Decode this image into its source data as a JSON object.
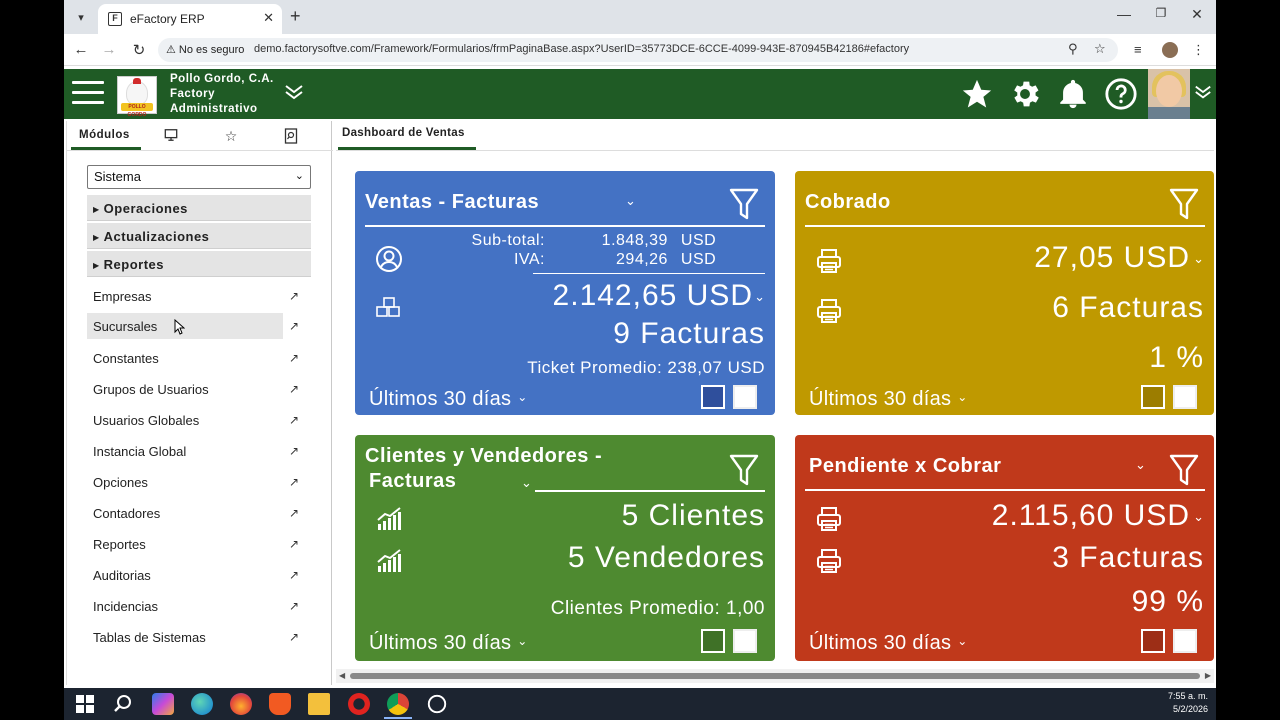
{
  "browser": {
    "tab_title": "eFactory ERP",
    "security_label": "No es seguro",
    "url": "demo.factorysoftve.com/Framework/Formularios/frmPaginaBase.aspx?UserID=35773DCE-6CCE-4099-943E-870945B42186#efactory"
  },
  "header": {
    "company_line1": "Pollo Gordo, C.A.",
    "company_line2": "Factory",
    "company_line3": "Administrativo",
    "logo_text": "POLLO GORDO"
  },
  "sidebar": {
    "tab_label": "Módulos",
    "select_value": "Sistema",
    "groups": [
      "Operaciones",
      "Actualizaciones",
      "Reportes"
    ],
    "items": [
      {
        "label": "Empresas"
      },
      {
        "label": "Sucursales"
      },
      {
        "label": "Constantes"
      },
      {
        "label": "Grupos de Usuarios"
      },
      {
        "label": "Usuarios Globales"
      },
      {
        "label": "Instancia Global"
      },
      {
        "label": "Opciones"
      },
      {
        "label": "Contadores"
      },
      {
        "label": "Reportes"
      },
      {
        "label": "Auditorias"
      },
      {
        "label": "Incidencias"
      },
      {
        "label": "Tablas de Sistemas"
      }
    ]
  },
  "main": {
    "tab_label": "Dashboard de Ventas"
  },
  "cards": {
    "ventas": {
      "title": "Ventas -  Facturas",
      "subtotal_label": "Sub-total:",
      "subtotal_value": "1.848,39",
      "subtotal_currency": "USD",
      "iva_label": "IVA:",
      "iva_value": "294,26",
      "iva_currency": "USD",
      "total": "2.142,65  USD",
      "count": "9 Facturas",
      "ticket": "Ticket Promedio: 238,07 USD",
      "range": "Últimos 30 días",
      "color": "#4472c4"
    },
    "cobrado": {
      "title": "Cobrado",
      "amount": "27,05  USD",
      "count": "6 Facturas",
      "percent": "1 %",
      "range": "Últimos 30 días",
      "color": "#bf9900"
    },
    "clientes": {
      "title_line1": "Clientes y Vendedores -",
      "title_line2": "Facturas",
      "clientes": "5 Clientes",
      "vendedores": "5 Vendedores",
      "promedio": "Clientes Promedio: 1,00",
      "range": "Últimos 30 días",
      "color": "#4e8a30"
    },
    "pendiente": {
      "title": "Pendiente x Cobrar",
      "amount": "2.115,60  USD",
      "count": "3 Facturas",
      "percent": "99 %",
      "range": "Últimos 30 días",
      "color": "#c0391b"
    }
  },
  "taskbar": {
    "time": "7:55 a. m.",
    "date": "5/2/2026"
  }
}
